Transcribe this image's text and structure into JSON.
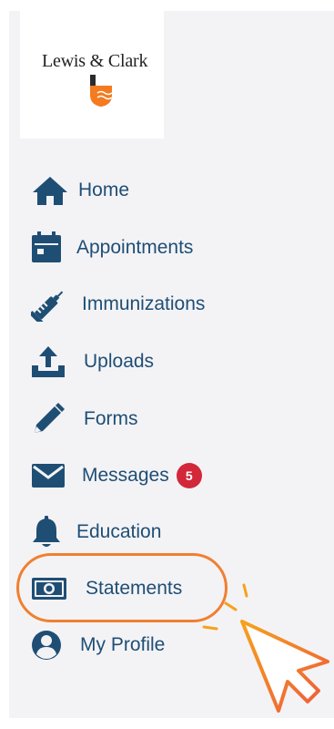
{
  "logo": {
    "text": "Lewis & Clark",
    "emblem_colors": [
      "#f47b20",
      "#2b2b2b"
    ]
  },
  "nav": {
    "items": [
      {
        "label": "Home",
        "icon": "home-icon"
      },
      {
        "label": "Appointments",
        "icon": "calendar-icon"
      },
      {
        "label": "Immunizations",
        "icon": "syringe-icon"
      },
      {
        "label": "Uploads",
        "icon": "upload-icon"
      },
      {
        "label": "Forms",
        "icon": "pencil-icon"
      },
      {
        "label": "Messages",
        "icon": "envelope-icon",
        "badge": "5"
      },
      {
        "label": "Education",
        "icon": "bell-icon"
      },
      {
        "label": "Statements",
        "icon": "money-icon",
        "highlighted": true
      },
      {
        "label": "My Profile",
        "icon": "user-circle-icon"
      }
    ]
  },
  "colors": {
    "nav_text": "#1f4e74",
    "badge": "#d2283a",
    "highlight": "#f08030",
    "panel": "#f3f3f6"
  }
}
